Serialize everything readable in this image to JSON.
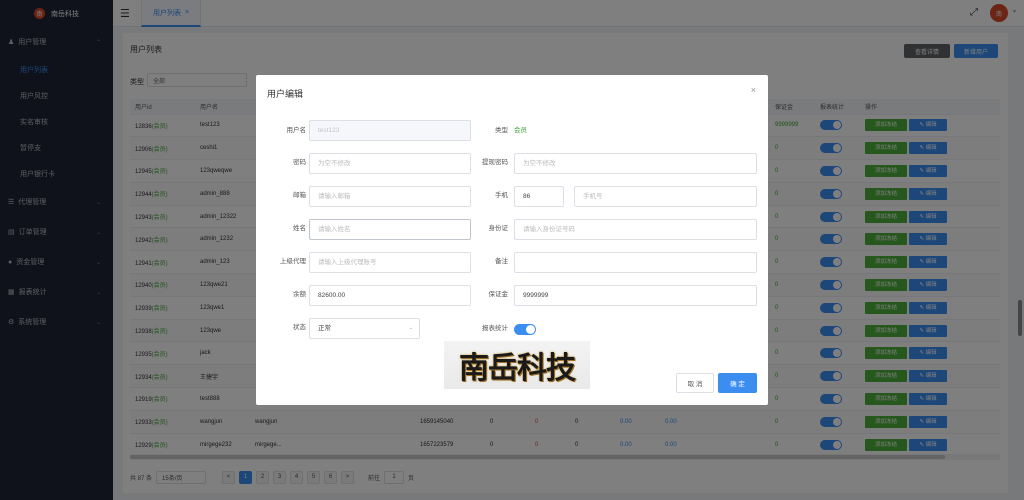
{
  "app": {
    "name": "南岳科技",
    "logo_text": "南"
  },
  "sidebar": {
    "groups": [
      {
        "label": "用户管理",
        "icon": "user-icon",
        "expanded": true,
        "items": [
          {
            "label": "用户列表",
            "active": true
          },
          {
            "label": "用户风控",
            "active": false
          },
          {
            "label": "实名审核",
            "active": false
          },
          {
            "label": "暂停支",
            "active": false
          },
          {
            "label": "用户银行卡",
            "active": false
          }
        ]
      },
      {
        "label": "代理管理",
        "icon": "agent-icon"
      },
      {
        "label": "订单管理",
        "icon": "order-icon"
      },
      {
        "label": "资金管理",
        "icon": "fund-icon"
      },
      {
        "label": "报表统计",
        "icon": "report-icon"
      },
      {
        "label": "系统管理",
        "icon": "settings-icon"
      }
    ]
  },
  "topbar": {
    "tab_label": "用户列表",
    "tab_close": "×",
    "avatar_text": "南"
  },
  "main": {
    "title": "用户列表",
    "btn_detail": "查看详情",
    "btn_new": "新增用户",
    "filter_label": "类型",
    "filter_value": "全部"
  },
  "table": {
    "headers": [
      "用户id",
      "用户名",
      "",
      "",
      "",
      "",
      "",
      "",
      "",
      "",
      "",
      "",
      "",
      "保证金",
      "报表统计",
      "操作"
    ],
    "rows": [
      {
        "id": "12836",
        "tag": "(会员)",
        "name": "test123",
        "col3": "",
        "phone": "",
        "deposit": "9999999"
      },
      {
        "id": "12906",
        "tag": "(会员)",
        "name": "ceshi1",
        "col3": "",
        "phone": "",
        "deposit": "0"
      },
      {
        "id": "12945",
        "tag": "(会员)",
        "name": "123qweqwe",
        "col3": "",
        "phone": "",
        "deposit": "0"
      },
      {
        "id": "12944",
        "tag": "(会员)",
        "name": "admin_888",
        "col3": "",
        "phone": "",
        "deposit": "0"
      },
      {
        "id": "12943",
        "tag": "(会员)",
        "name": "admin_12322",
        "col3": "",
        "phone": "",
        "deposit": "0"
      },
      {
        "id": "12942",
        "tag": "(会员)",
        "name": "admin_1232",
        "col3": "",
        "phone": "",
        "deposit": "0"
      },
      {
        "id": "12941",
        "tag": "(会员)",
        "name": "admin_123",
        "col3": "",
        "phone": "",
        "deposit": "0"
      },
      {
        "id": "12940",
        "tag": "(会员)",
        "name": "123qwe21",
        "col3": "",
        "phone": "",
        "deposit": "0"
      },
      {
        "id": "12939",
        "tag": "(会员)",
        "name": "123qwe1",
        "col3": "",
        "phone": "",
        "deposit": "0"
      },
      {
        "id": "12938",
        "tag": "(会员)",
        "name": "123qwe",
        "col3": "",
        "phone": "",
        "deposit": "0"
      },
      {
        "id": "12935",
        "tag": "(会员)",
        "name": "jack",
        "col3": "",
        "phone": "",
        "deposit": "0"
      },
      {
        "id": "12934",
        "tag": "(会员)",
        "name": "王捷宇",
        "col3": "",
        "phone": "",
        "deposit": "0"
      },
      {
        "id": "12919",
        "tag": "(会员)",
        "name": "test888",
        "col3": "",
        "phone": "",
        "deposit": "0"
      },
      {
        "id": "12933",
        "tag": "(会员)",
        "name": "wangjun",
        "col3": "wangjun",
        "phone": "1659145040",
        "deposit": "0"
      },
      {
        "id": "12929",
        "tag": "(会员)",
        "name": "mirgege232",
        "col3": "mirgege...",
        "phone": "1657223579",
        "deposit": "0"
      }
    ],
    "zero": "0",
    "money_zero": "0.00",
    "add_btn": "添加冻结",
    "edit_btn": "编辑"
  },
  "pager": {
    "total": "共 87 条",
    "page_size": "15条/页",
    "prev": "<",
    "pages": [
      "1",
      "2",
      "3",
      "4",
      "5",
      "6"
    ],
    "next": ">",
    "goto_label": "前往",
    "goto_value": "1",
    "goto_suffix": "页",
    "current_page": 1
  },
  "modal": {
    "title": "用户编辑",
    "close": "×",
    "fields": {
      "username_label": "用户名",
      "username_value": "test123",
      "type_label": "类型",
      "type_value": "会员",
      "password_label": "密码",
      "password_placeholder": "为空不修改",
      "withdraw_label": "提现密码",
      "withdraw_placeholder": "为空不修改",
      "email_label": "邮箱",
      "email_placeholder": "请输入邮箱",
      "phone_label": "手机",
      "phone_code": "86",
      "phone_placeholder": "手机号",
      "name_label": "姓名",
      "name_placeholder": "请输入姓名",
      "idcard_label": "身份证",
      "idcard_placeholder": "请输入身份证号码",
      "agent_label": "上级代理",
      "agent_placeholder": "请输入上级代理账号",
      "remark_label": "备注",
      "remark_value": "",
      "balance_label": "余额",
      "balance_value": "82600.00",
      "deposit_label": "保证金",
      "deposit_value": "9999999",
      "status_label": "状态",
      "status_value": "正常",
      "report_label": "报表统计",
      "report_on": true
    },
    "watermark_text": "南岳科技",
    "cancel": "取 消",
    "ok": "确 定"
  },
  "colors": {
    "primary": "#3b8ef0",
    "success": "#4caf38",
    "sidebar": "#1f2535",
    "brand": "#d94b2b"
  }
}
